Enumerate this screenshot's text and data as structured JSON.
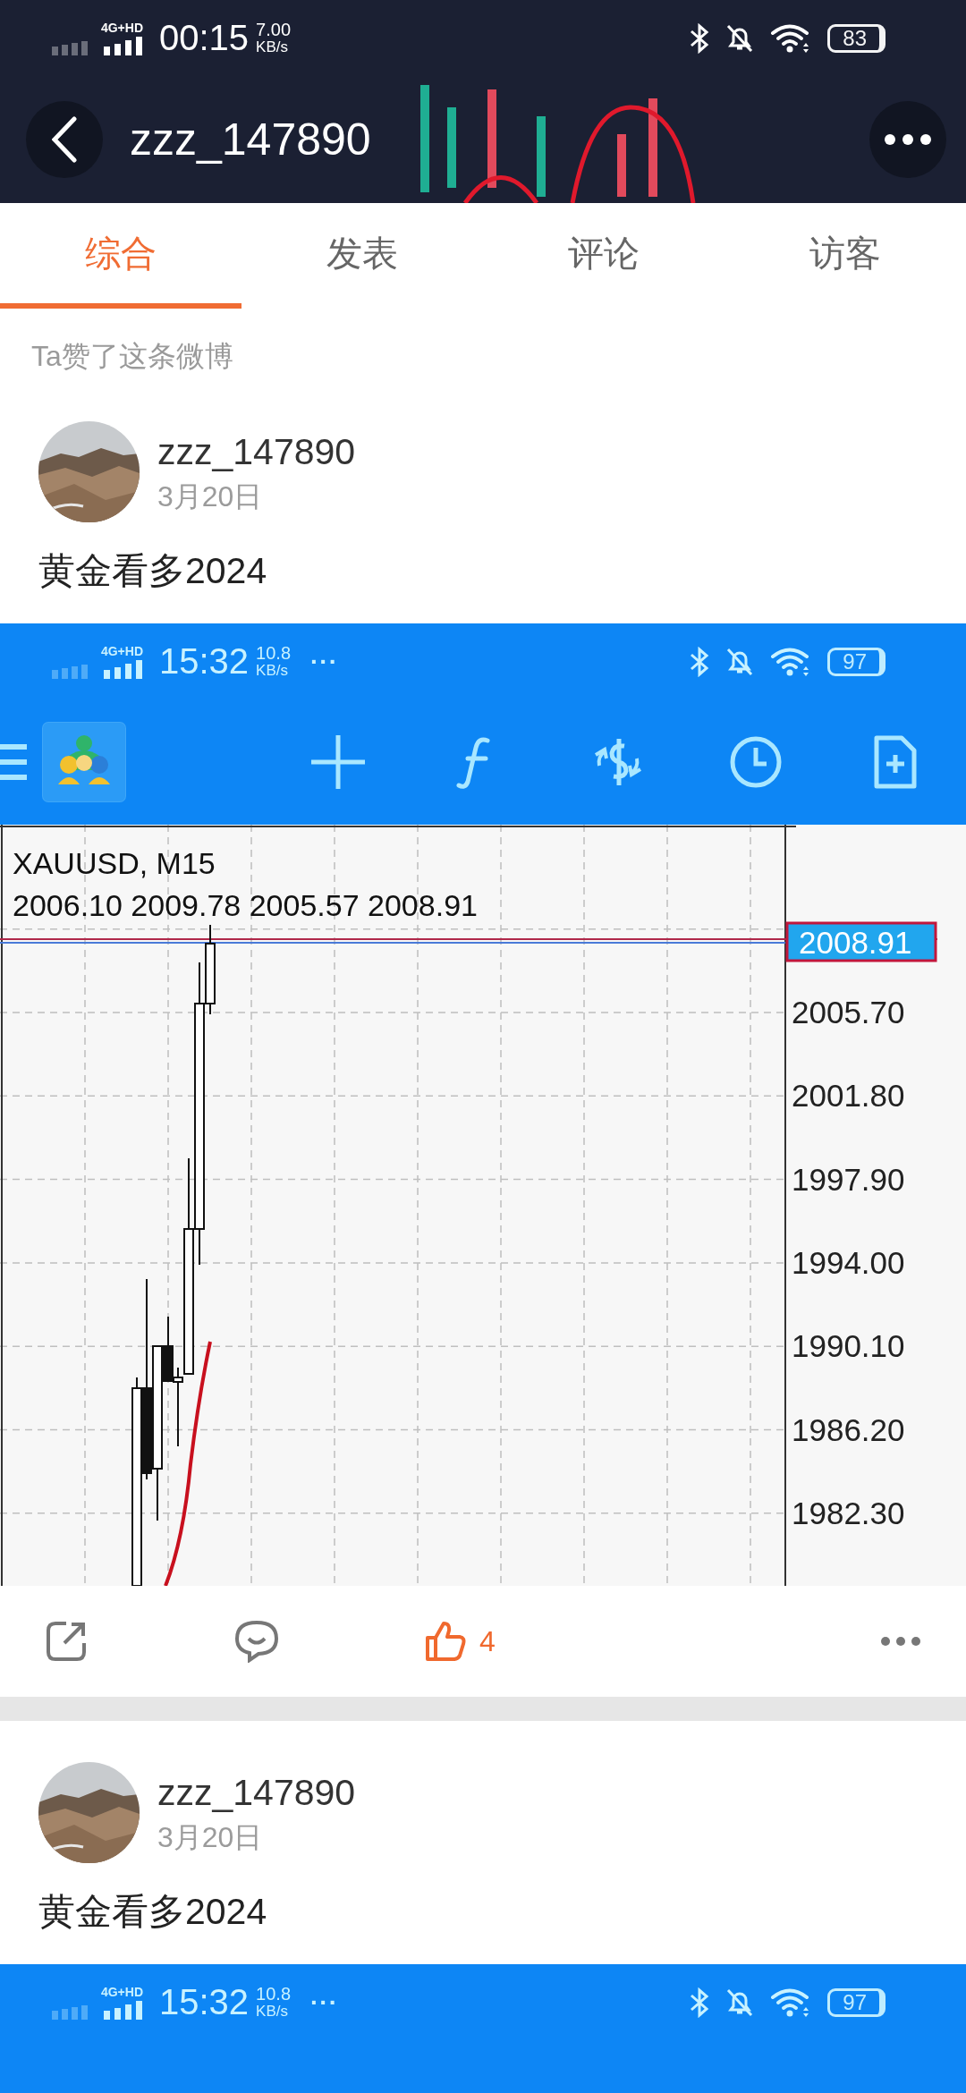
{
  "header": {
    "status_bar": {
      "network": "4G+HD",
      "time": "00:15",
      "speed": "7.00",
      "speed_unit": "KB/s",
      "battery": "83"
    },
    "title": "zzz_147890"
  },
  "tabs": [
    {
      "label": "综合",
      "selected": true
    },
    {
      "label": "发表",
      "selected": false
    },
    {
      "label": "评论",
      "selected": false
    },
    {
      "label": "访客",
      "selected": false
    }
  ],
  "posts": [
    {
      "context": "Ta赞了这条微博",
      "author": "zzz_147890",
      "date": "3月20日",
      "text": "黄金看多2024",
      "screenshot": {
        "status_bar": {
          "network": "4G+HD",
          "time": "15:32",
          "speed": "10.8",
          "speed_unit": "KB/s",
          "more": "···",
          "battery": "97"
        },
        "chart": {
          "symbol": "XAUUSD, M15",
          "ohlc": "2006.10 2009.78 2005.57 2008.91",
          "price": "2008.91",
          "axis_labels": [
            "2005.70",
            "2001.80",
            "1997.90",
            "1994.00",
            "1990.10",
            "1986.20",
            "1982.30"
          ]
        }
      },
      "actions": {
        "likes": "4",
        "liked": true
      }
    },
    {
      "author": "zzz_147890",
      "date": "3月20日",
      "text": "黄金看多2024",
      "screenshot": {
        "status_bar": {
          "network": "4G+HD",
          "time": "15:32",
          "speed": "10.8",
          "speed_unit": "KB/s",
          "more": "···",
          "battery": "97"
        }
      }
    }
  ]
}
